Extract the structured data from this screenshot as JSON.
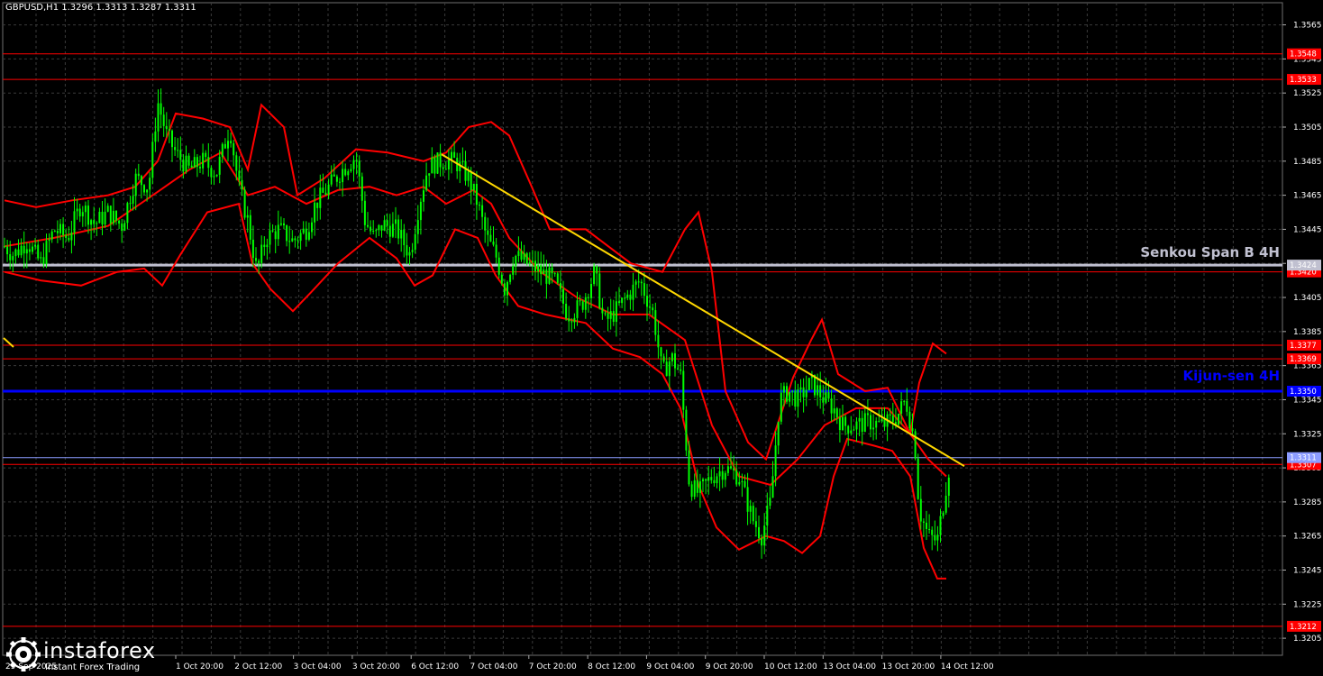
{
  "window": {
    "title": "GBPUSD,H1  1.3296 1.3313 1.3287 1.3311"
  },
  "watermark": {
    "brand": "instaforex",
    "tagline": "Instant Forex Trading"
  },
  "colors": {
    "background": "#000000",
    "grid": "#3a3a3a",
    "candles": "#00ff00",
    "bands": "#ff0000",
    "trendline": "#ffd700",
    "kijun": "#0000ff",
    "senkou": "#c0c0d0",
    "level": "#ff0000",
    "price_line": "#8c9cff"
  },
  "chart_data": {
    "type": "line",
    "symbol": "GBPUSD",
    "timeframe": "H1",
    "ylim": [
      1.3195,
      1.3578
    ],
    "y_ticks": [
      1.3565,
      1.3545,
      1.3525,
      1.3505,
      1.3485,
      1.3465,
      1.3445,
      1.3425,
      1.3405,
      1.3385,
      1.3365,
      1.3345,
      1.3325,
      1.3305,
      1.3285,
      1.3265,
      1.3245,
      1.3225,
      1.3205
    ],
    "x_labels": [
      "1 Oct 20:00",
      "2 Oct 12:00",
      "3 Oct 04:00",
      "3 Oct 20:00",
      "6 Oct 12:00",
      "7 Oct 04:00",
      "7 Oct 20:00",
      "8 Oct 12:00",
      "9 Oct 04:00",
      "9 Oct 20:00",
      "10 Oct 12:00",
      "13 Oct 04:00",
      "13 Oct 20:00",
      "14 Oct 12:00"
    ],
    "x_start_label": "29 Sep 2025",
    "horizontal_levels": [
      {
        "price": 1.3548,
        "label": "1.3548"
      },
      {
        "price": 1.3533,
        "label": "1.3533"
      },
      {
        "price": 1.342,
        "label": "1.3420"
      },
      {
        "price": 1.3377,
        "label": "1.3377"
      },
      {
        "price": 1.3369,
        "label": "1.3369"
      },
      {
        "price": 1.3307,
        "label": "1.3307"
      },
      {
        "price": 1.3212,
        "label": "1.3212"
      }
    ],
    "senkou_span_b": {
      "price": 1.3424,
      "label": "1.3424",
      "name": "Senkou Span B 4H"
    },
    "kijun_sen": {
      "price": 1.335,
      "label": "1.3350",
      "name": "Kijun-sen 4H"
    },
    "current_price": {
      "price": 1.3311,
      "label": "1.3311"
    },
    "trendline": {
      "start": [
        490,
        1.3489
      ],
      "end": [
        1070,
        1.3306
      ]
    },
    "price_series": [
      [
        5,
        1.3435
      ],
      [
        15,
        1.343
      ],
      [
        30,
        1.3438
      ],
      [
        45,
        1.3425
      ],
      [
        60,
        1.3445
      ],
      [
        75,
        1.344
      ],
      [
        90,
        1.346
      ],
      [
        105,
        1.3448
      ],
      [
        120,
        1.3455
      ],
      [
        135,
        1.3447
      ],
      [
        150,
        1.3475
      ],
      [
        165,
        1.347
      ],
      [
        175,
        1.352
      ],
      [
        185,
        1.35
      ],
      [
        195,
        1.349
      ],
      [
        210,
        1.348
      ],
      [
        225,
        1.3485
      ],
      [
        240,
        1.3478
      ],
      [
        255,
        1.3505
      ],
      [
        265,
        1.347
      ],
      [
        275,
        1.345
      ],
      [
        285,
        1.342
      ],
      [
        295,
        1.344
      ],
      [
        310,
        1.3445
      ],
      [
        325,
        1.3438
      ],
      [
        340,
        1.3445
      ],
      [
        350,
        1.346
      ],
      [
        365,
        1.347
      ],
      [
        380,
        1.348
      ],
      [
        395,
        1.3488
      ],
      [
        405,
        1.345
      ],
      [
        415,
        1.344
      ],
      [
        425,
        1.3448
      ],
      [
        440,
        1.3445
      ],
      [
        455,
        1.343
      ],
      [
        465,
        1.346
      ],
      [
        475,
        1.3482
      ],
      [
        490,
        1.3485
      ],
      [
        505,
        1.3485
      ],
      [
        520,
        1.3475
      ],
      [
        530,
        1.346
      ],
      [
        540,
        1.344
      ],
      [
        550,
        1.343
      ],
      [
        560,
        1.341
      ],
      [
        570,
        1.343
      ],
      [
        585,
        1.3425
      ],
      [
        600,
        1.342
      ],
      [
        615,
        1.3415
      ],
      [
        630,
        1.3395
      ],
      [
        645,
        1.34
      ],
      [
        660,
        1.342
      ],
      [
        670,
        1.339
      ],
      [
        680,
        1.3395
      ],
      [
        695,
        1.3405
      ],
      [
        710,
        1.3415
      ],
      [
        725,
        1.3395
      ],
      [
        735,
        1.336
      ],
      [
        745,
        1.337
      ],
      [
        755,
        1.336
      ],
      [
        765,
        1.3295
      ],
      [
        775,
        1.329
      ],
      [
        790,
        1.33
      ],
      [
        805,
        1.3305
      ],
      [
        820,
        1.33
      ],
      [
        835,
        1.3275
      ],
      [
        845,
        1.3265
      ],
      [
        855,
        1.3285
      ],
      [
        865,
        1.3345
      ],
      [
        875,
        1.335
      ],
      [
        885,
        1.3345
      ],
      [
        900,
        1.3355
      ],
      [
        915,
        1.3345
      ],
      [
        925,
        1.334
      ],
      [
        935,
        1.333
      ],
      [
        950,
        1.333
      ],
      [
        965,
        1.3332
      ],
      [
        980,
        1.333
      ],
      [
        995,
        1.3335
      ],
      [
        1005,
        1.3345
      ],
      [
        1015,
        1.332
      ],
      [
        1020,
        1.328
      ],
      [
        1030,
        1.3265
      ],
      [
        1040,
        1.3262
      ],
      [
        1050,
        1.3295
      ],
      [
        1055,
        1.3311
      ]
    ],
    "band_upper": [
      [
        5,
        1.3462
      ],
      [
        40,
        1.3458
      ],
      [
        80,
        1.3462
      ],
      [
        120,
        1.3465
      ],
      [
        150,
        1.347
      ],
      [
        175,
        1.3485
      ],
      [
        195,
        1.3513
      ],
      [
        225,
        1.351
      ],
      [
        255,
        1.3505
      ],
      [
        275,
        1.348
      ],
      [
        290,
        1.3518
      ],
      [
        315,
        1.3505
      ],
      [
        330,
        1.3465
      ],
      [
        360,
        1.3475
      ],
      [
        395,
        1.3492
      ],
      [
        430,
        1.349
      ],
      [
        470,
        1.3485
      ],
      [
        495,
        1.349
      ],
      [
        520,
        1.3505
      ],
      [
        545,
        1.3508
      ],
      [
        565,
        1.35
      ],
      [
        590,
        1.347
      ],
      [
        610,
        1.3445
      ],
      [
        650,
        1.3445
      ],
      [
        700,
        1.3425
      ],
      [
        735,
        1.342
      ],
      [
        760,
        1.3445
      ],
      [
        775,
        1.3455
      ],
      [
        790,
        1.342
      ],
      [
        805,
        1.335
      ],
      [
        830,
        1.332
      ],
      [
        850,
        1.331
      ],
      [
        880,
        1.3358
      ],
      [
        900,
        1.338
      ],
      [
        912,
        1.3392
      ],
      [
        930,
        1.336
      ],
      [
        960,
        1.335
      ],
      [
        985,
        1.3352
      ],
      [
        1010,
        1.3325
      ],
      [
        1020,
        1.3355
      ],
      [
        1035,
        1.3378
      ],
      [
        1050,
        1.3372
      ]
    ],
    "band_middle": [
      [
        5,
        1.3435
      ],
      [
        60,
        1.344
      ],
      [
        120,
        1.3447
      ],
      [
        175,
        1.3467
      ],
      [
        210,
        1.348
      ],
      [
        245,
        1.349
      ],
      [
        275,
        1.3465
      ],
      [
        305,
        1.347
      ],
      [
        340,
        1.346
      ],
      [
        375,
        1.3468
      ],
      [
        410,
        1.347
      ],
      [
        440,
        1.3465
      ],
      [
        470,
        1.347
      ],
      [
        495,
        1.346
      ],
      [
        525,
        1.3468
      ],
      [
        545,
        1.346
      ],
      [
        565,
        1.344
      ],
      [
        600,
        1.342
      ],
      [
        640,
        1.3405
      ],
      [
        680,
        1.3395
      ],
      [
        720,
        1.3395
      ],
      [
        760,
        1.338
      ],
      [
        790,
        1.333
      ],
      [
        820,
        1.33
      ],
      [
        855,
        1.3295
      ],
      [
        885,
        1.331
      ],
      [
        915,
        1.333
      ],
      [
        950,
        1.334
      ],
      [
        985,
        1.334
      ],
      [
        1010,
        1.3325
      ],
      [
        1030,
        1.331
      ],
      [
        1050,
        1.33
      ]
    ],
    "band_lower": [
      [
        5,
        1.342
      ],
      [
        45,
        1.3415
      ],
      [
        90,
        1.3412
      ],
      [
        130,
        1.342
      ],
      [
        160,
        1.3422
      ],
      [
        180,
        1.3412
      ],
      [
        200,
        1.343
      ],
      [
        230,
        1.3455
      ],
      [
        265,
        1.346
      ],
      [
        280,
        1.3425
      ],
      [
        300,
        1.341
      ],
      [
        325,
        1.3397
      ],
      [
        345,
        1.3408
      ],
      [
        375,
        1.3425
      ],
      [
        410,
        1.344
      ],
      [
        440,
        1.3428
      ],
      [
        460,
        1.3412
      ],
      [
        480,
        1.3418
      ],
      [
        505,
        1.3445
      ],
      [
        530,
        1.344
      ],
      [
        550,
        1.3418
      ],
      [
        575,
        1.34
      ],
      [
        605,
        1.3395
      ],
      [
        650,
        1.339
      ],
      [
        680,
        1.3375
      ],
      [
        710,
        1.337
      ],
      [
        735,
        1.336
      ],
      [
        755,
        1.334
      ],
      [
        775,
        1.3295
      ],
      [
        795,
        1.327
      ],
      [
        820,
        1.3257
      ],
      [
        850,
        1.3265
      ],
      [
        870,
        1.3262
      ],
      [
        890,
        1.3255
      ],
      [
        910,
        1.3265
      ],
      [
        925,
        1.33
      ],
      [
        940,
        1.3322
      ],
      [
        970,
        1.3318
      ],
      [
        990,
        1.3315
      ],
      [
        1010,
        1.33
      ],
      [
        1025,
        1.3258
      ],
      [
        1040,
        1.324
      ],
      [
        1050,
        1.324
      ]
    ]
  }
}
